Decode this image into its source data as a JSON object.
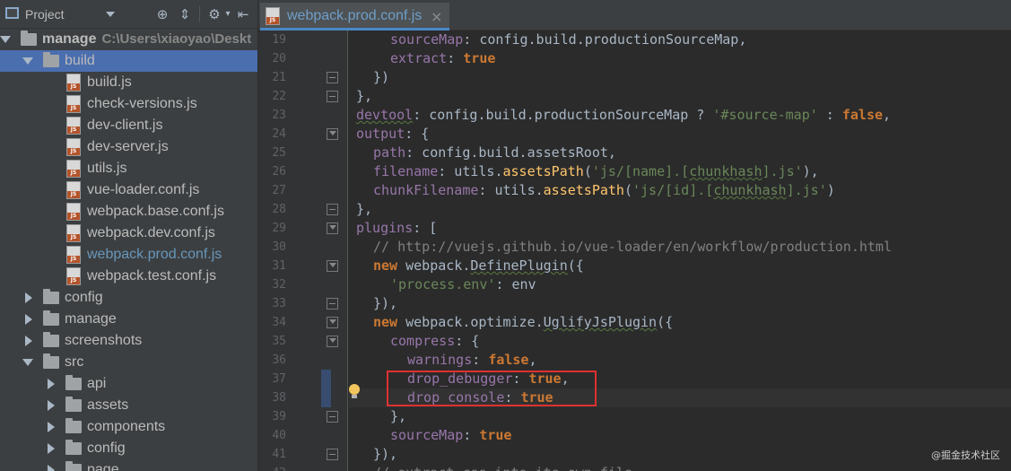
{
  "project_panel": {
    "title": "Project",
    "tree": [
      {
        "label": "manage",
        "path": "C:\\Users\\xiaoyao\\Deskt",
        "type": "folder",
        "expanded": true,
        "depth": 0
      },
      {
        "label": "build",
        "type": "folder",
        "expanded": true,
        "depth": 1,
        "selected": true
      },
      {
        "label": "build.js",
        "type": "file",
        "depth": 2
      },
      {
        "label": "check-versions.js",
        "type": "file",
        "depth": 2
      },
      {
        "label": "dev-client.js",
        "type": "file",
        "depth": 2
      },
      {
        "label": "dev-server.js",
        "type": "file",
        "depth": 2
      },
      {
        "label": "utils.js",
        "type": "file",
        "depth": 2
      },
      {
        "label": "vue-loader.conf.js",
        "type": "file",
        "depth": 2
      },
      {
        "label": "webpack.base.conf.js",
        "type": "file",
        "depth": 2
      },
      {
        "label": "webpack.dev.conf.js",
        "type": "file",
        "depth": 2
      },
      {
        "label": "webpack.prod.conf.js",
        "type": "file",
        "depth": 2,
        "open": true
      },
      {
        "label": "webpack.test.conf.js",
        "type": "file",
        "depth": 2
      },
      {
        "label": "config",
        "type": "folder",
        "expanded": false,
        "depth": 1
      },
      {
        "label": "manage",
        "type": "folder",
        "expanded": false,
        "depth": 1
      },
      {
        "label": "screenshots",
        "type": "folder",
        "expanded": false,
        "depth": 1
      },
      {
        "label": "src",
        "type": "folder",
        "expanded": true,
        "depth": 1
      },
      {
        "label": "api",
        "type": "folder",
        "expanded": false,
        "depth": 2
      },
      {
        "label": "assets",
        "type": "folder",
        "expanded": false,
        "depth": 2
      },
      {
        "label": "components",
        "type": "folder",
        "expanded": false,
        "depth": 2
      },
      {
        "label": "config",
        "type": "folder",
        "expanded": false,
        "depth": 2
      },
      {
        "label": "page",
        "type": "folder",
        "expanded": false,
        "depth": 2
      }
    ]
  },
  "editor": {
    "tab": {
      "label": "webpack.prod.conf.js",
      "close": "×"
    },
    "lines": [
      {
        "n": "19",
        "html": "<span style='padding-left:38px'></span><span class='t-key'>sourceMap</span>: config.build.productionSourceMap,"
      },
      {
        "n": "20",
        "html": "<span style='padding-left:38px'></span><span class='t-key'>extract</span>: <span class='t-kw'>true</span>"
      },
      {
        "n": "21",
        "html": "<span style='padding-left:19px'></span>})"
      },
      {
        "n": "22",
        "html": "},"
      },
      {
        "n": "23",
        "html": "<span class='t-key t-u'>devtool</span>: config.build.productionSourceMap ? <span class='t-str'>'#source-map'</span> : <span class='t-kw'>false</span>,"
      },
      {
        "n": "24",
        "html": "<span class='t-key'>output</span>: {"
      },
      {
        "n": "25",
        "html": "<span style='padding-left:19px'></span><span class='t-key'>path</span>: config.build.assetsRoot,"
      },
      {
        "n": "26",
        "html": "<span style='padding-left:19px'></span><span class='t-key'>filename</span>: utils.<span class='t-fn'>assetsPath</span>(<span class='t-str'>'js/[name].[<span class=\"t-u\">chunkhash</span>].js'</span>),"
      },
      {
        "n": "27",
        "html": "<span style='padding-left:19px'></span><span class='t-key'>chunkFilename</span>: utils.<span class='t-fn'>assetsPath</span>(<span class='t-str'>'js/[id].[<span class=\"t-u\">chunkhash</span>].js'</span>)"
      },
      {
        "n": "28",
        "html": "},"
      },
      {
        "n": "29",
        "html": "<span class='t-key'>plugins</span>: ["
      },
      {
        "n": "30",
        "html": "<span style='padding-left:19px'></span><span class='t-cmt'>// http://vuejs.github.io/vue-loader/en/workflow/production.html</span>"
      },
      {
        "n": "31",
        "html": "<span style='padding-left:19px'></span><span class='t-kw'>new</span> webpack.<span class='t-u'>DefinePlugin</span>({"
      },
      {
        "n": "32",
        "html": "<span style='padding-left:38px'></span><span class='t-str'>'process.env'</span>: env"
      },
      {
        "n": "33",
        "html": "<span style='padding-left:19px'></span>}),"
      },
      {
        "n": "34",
        "html": "<span style='padding-left:19px'></span><span class='t-kw'>new</span> webpack.optimize.<span class='t-u'>UglifyJsPlugin</span>({"
      },
      {
        "n": "35",
        "html": "<span style='padding-left:38px'></span><span class='t-key'>compress</span>: {"
      },
      {
        "n": "36",
        "html": "<span style='padding-left:57px'></span><span class='t-key'>warnings</span>: <span class='t-kw'>false</span>,"
      },
      {
        "n": "37",
        "html": "<span style='padding-left:57px'></span><span class='t-key'>drop_debugger</span>: <span class='t-kw'>true</span>,"
      },
      {
        "n": "38",
        "html": "<span style='padding-left:57px'></span><span class='t-key'>drop_console</span>: <span class='t-kw'>true</span>"
      },
      {
        "n": "39",
        "html": "<span style='padding-left:38px'></span>},"
      },
      {
        "n": "40",
        "html": "<span style='padding-left:38px'></span><span class='t-key'>sourceMap</span>: <span class='t-kw'>true</span>"
      },
      {
        "n": "41",
        "html": "<span style='padding-left:19px'></span>}),"
      },
      {
        "n": "42",
        "html": "<span style='padding-left:19px'></span><span class='t-cmt'>// extract css into its own file</span>"
      }
    ]
  },
  "watermark": "@掘金技术社区",
  "colors": {
    "selection": "#4b6eaf",
    "highlight_box": "#e03030",
    "keyword": "#cc7832",
    "property": "#9876aa",
    "string": "#6a8759"
  }
}
